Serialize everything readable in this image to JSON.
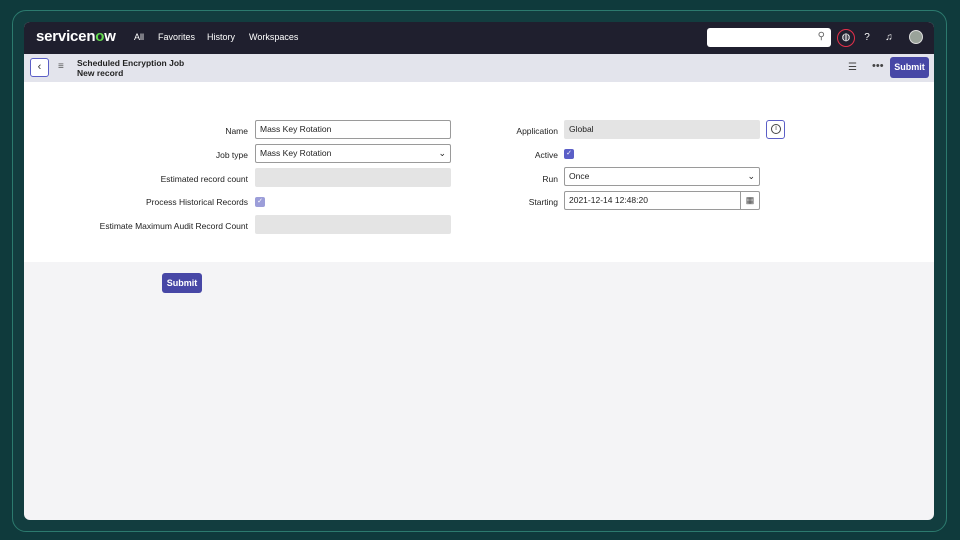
{
  "nav": {
    "logo_prefix": "servicen",
    "logo_o": "o",
    "logo_suffix": "w",
    "links": [
      "All",
      "Favorites",
      "History",
      "Workspaces"
    ],
    "search_icon": "⚲",
    "globe_icon": "◍",
    "help_icon": "?",
    "bell_icon": "♫"
  },
  "header": {
    "title_line1": "Scheduled Encryption Job",
    "title_line2": "New record",
    "back_icon": "‹",
    "menu_icon": "≡",
    "sliders_icon": "☰",
    "more_icon": "•••",
    "submit_label": "Submit"
  },
  "form": {
    "name_label": "Name",
    "name_value": "Mass Key Rotation",
    "jobtype_label": "Job type",
    "jobtype_value": "Mass Key Rotation",
    "est_label": "Estimated record count",
    "est_value": "",
    "proc_label": "Process Historical Records",
    "estmax_label": "Estimate Maximum Audit Record Count",
    "estmax_value": "",
    "app_label": "Application",
    "app_value": "Global",
    "info_icon": "i",
    "active_label": "Active",
    "run_label": "Run",
    "run_value": "Once",
    "starting_label": "Starting",
    "starting_value": "2021-12-14 12:48:20",
    "calendar_icon": "▦",
    "check_mark": "✓",
    "caret": "⌄",
    "submit_label": "Submit"
  }
}
